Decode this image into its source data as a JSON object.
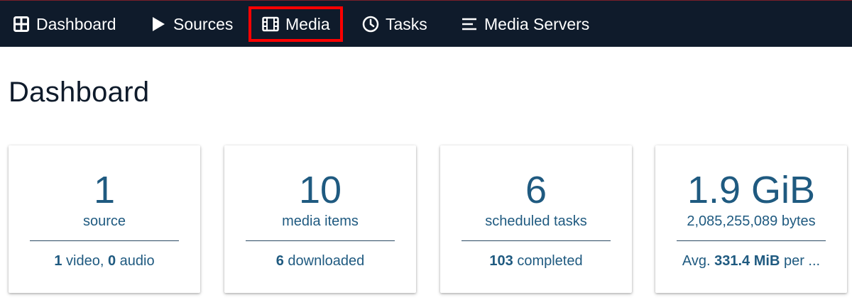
{
  "nav": {
    "items": [
      {
        "label": "Dashboard",
        "icon": "dashboard-grid-icon"
      },
      {
        "label": "Sources",
        "icon": "play-icon"
      },
      {
        "label": "Media",
        "icon": "film-icon",
        "highlighted": true
      },
      {
        "label": "Tasks",
        "icon": "clock-icon"
      },
      {
        "label": "Media Servers",
        "icon": "list-icon"
      }
    ]
  },
  "page": {
    "title": "Dashboard"
  },
  "cards": [
    {
      "value": "1",
      "label": "source",
      "foot": {
        "n1": "1",
        "t1": " video, ",
        "n2": "0",
        "t2": " audio"
      }
    },
    {
      "value": "10",
      "label": "media items",
      "foot": {
        "n1": "6",
        "t1": " downloaded"
      }
    },
    {
      "value": "6",
      "label": "scheduled tasks",
      "foot": {
        "n1": "103",
        "t1": " completed"
      }
    },
    {
      "value": "1.9 GiB",
      "label": "2,085,255,089 bytes",
      "foot": {
        "t0": "Avg. ",
        "n1": "331.4 MiB",
        "t1": " per ..."
      }
    }
  ],
  "colors": {
    "topbar": "#0f1b2b",
    "accent_text": "#1f5a80",
    "highlight_box": "#ff0000"
  }
}
